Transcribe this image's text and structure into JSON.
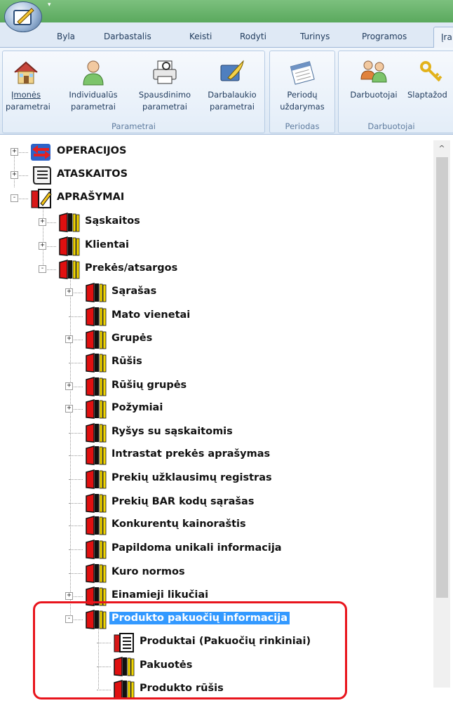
{
  "tabs": [
    {
      "label": "Byla"
    },
    {
      "label": "Darbastalis"
    },
    {
      "label": "Keisti"
    },
    {
      "label": "Rodyti"
    },
    {
      "label": "Turinys"
    },
    {
      "label": "Programos"
    },
    {
      "label": "Įra"
    }
  ],
  "ribbon": {
    "groups": [
      {
        "label": "Parametrai",
        "buttons": [
          {
            "line1": "Įmonės",
            "line2": "parametrai",
            "icon": "house-icon"
          },
          {
            "line1": "Individualūs",
            "line2": "parametrai",
            "icon": "person-icon"
          },
          {
            "line1": "Spausdinimo",
            "line2": "parametrai",
            "icon": "printer-icon"
          },
          {
            "line1": "Darbalaukio",
            "line2": "parametrai",
            "icon": "desktop-feather-icon"
          }
        ]
      },
      {
        "label": "Periodas",
        "buttons": [
          {
            "line1": "Periodų",
            "line2": "uždarymas",
            "icon": "calendar-icon"
          }
        ]
      },
      {
        "label": "Darbuotojai",
        "buttons": [
          {
            "line1": "Darbuotojai",
            "line2": "",
            "icon": "people-icon"
          },
          {
            "line1": "Slaptažod",
            "line2": "",
            "icon": "keys-icon"
          }
        ]
      }
    ]
  },
  "tree": [
    {
      "label": "OPERACIJOS",
      "icon": "operations-arrows-icon"
    },
    {
      "label": "ATASKAITOS",
      "icon": "reports-scroll-icon"
    },
    {
      "label": "APRAŠYMAI",
      "icon": "descriptions-book-icon"
    },
    {
      "label": "Sąskaitos",
      "icon": "book-folder-icon"
    },
    {
      "label": "Klientai",
      "icon": "book-folder-icon"
    },
    {
      "label": "Prekės/atsargos",
      "icon": "book-folder-icon"
    },
    {
      "label": "Sąrašas",
      "icon": "book-folder-icon"
    },
    {
      "label": "Mato vienetai",
      "icon": "book-folder-icon"
    },
    {
      "label": "Grupės",
      "icon": "book-folder-icon"
    },
    {
      "label": "Rūšis",
      "icon": "book-folder-icon"
    },
    {
      "label": "Rūšių grupės",
      "icon": "book-folder-icon"
    },
    {
      "label": "Požymiai",
      "icon": "book-folder-icon"
    },
    {
      "label": "Ryšys su sąskaitomis",
      "icon": "book-folder-icon"
    },
    {
      "label": "Intrastat prekės aprašymas",
      "icon": "book-folder-icon"
    },
    {
      "label": "Prekių užklausimų registras",
      "icon": "book-folder-icon"
    },
    {
      "label": "Prekių BAR kodų sąrašas",
      "icon": "book-folder-icon"
    },
    {
      "label": "Konkurentų kainoraštis",
      "icon": "book-folder-icon"
    },
    {
      "label": "Papildoma unikali informacija",
      "icon": "book-folder-icon"
    },
    {
      "label": "Kuro normos",
      "icon": "book-folder-icon"
    },
    {
      "label": "Einamieji likučiai",
      "icon": "book-folder-icon"
    },
    {
      "label": "Produkto pakuočių informacija",
      "icon": "book-folder-icon"
    },
    {
      "label": "Produktai (Pakuočių rinkiniai)",
      "icon": "list-document-icon"
    },
    {
      "label": "Pakuotės",
      "icon": "book-folder-icon"
    },
    {
      "label": "Produkto rūšis",
      "icon": "book-folder-icon"
    }
  ],
  "colors": {
    "titlebar": "#5aa95d",
    "selection": "#3399ff",
    "highlight": "#e8141c"
  }
}
